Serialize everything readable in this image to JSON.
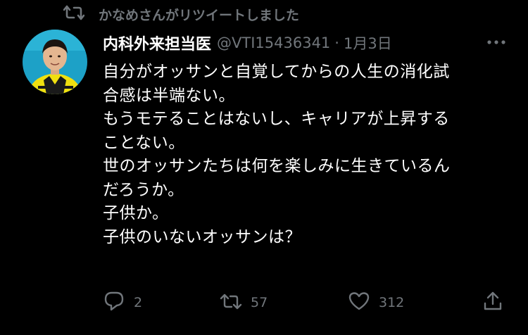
{
  "retweet": {
    "icon": "retweet-icon",
    "text": "かなめさんがリツイートしました"
  },
  "tweet": {
    "author_name": "内科外来担当医",
    "handle": "@VTI15436341",
    "separator": "·",
    "date": "1月3日",
    "lines": [
      "自分がオッサンと自覚してからの人生の消化試",
      "合感は半端ない。",
      "もうモテることはないし、キャリアが上昇する",
      "ことない。",
      "世のオッサンたちは何を楽しみに生きているん",
      "だろうか。",
      "子供か。",
      "子供のいないオッサンは？"
    ]
  },
  "actions": {
    "reply_count": "2",
    "retweet_count": "57",
    "like_count": "312"
  },
  "colors": {
    "background": "#000000",
    "text": "#ffffff",
    "secondary": "#71767b",
    "avatar_bg": "#1da1c7",
    "jersey": "#f0e010"
  }
}
